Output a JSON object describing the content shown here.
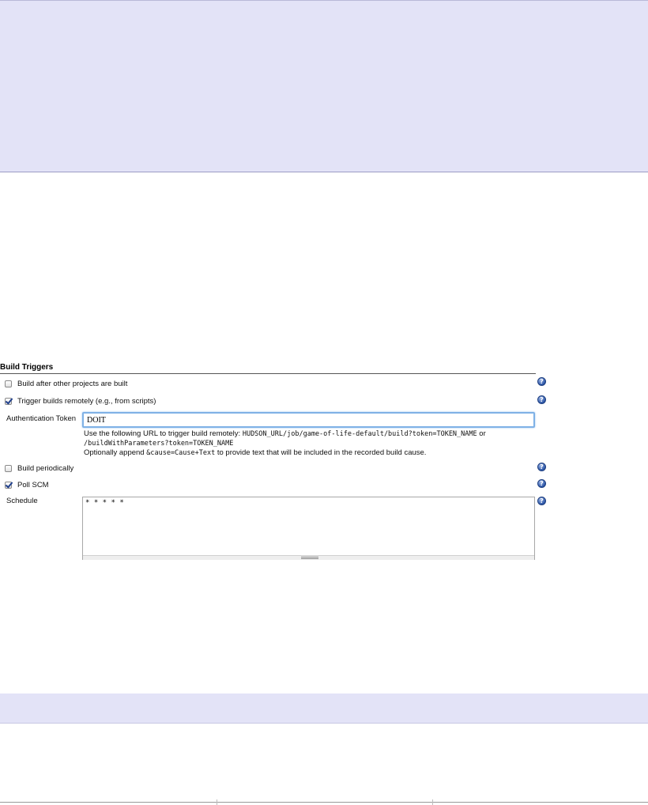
{
  "build_triggers": {
    "section_title": "Build Triggers",
    "build_after_other": {
      "label": "Build after other projects are built",
      "checked": false
    },
    "trigger_remotely": {
      "label": "Trigger builds remotely (e.g., from scripts)",
      "checked": true
    },
    "auth_token": {
      "label": "Authentication Token",
      "value": "DOIT",
      "help_line1_prefix": "Use the following URL to trigger build remotely: ",
      "help_line1_url": "HUDSON_URL/job/game-of-life-default/build?token=TOKEN_NAME",
      "help_line1_suffix": " or",
      "help_line2_url": "/buildWithParameters?token=TOKEN_NAME",
      "help_line3_prefix": "Optionally append ",
      "help_line3_code": "&cause=Cause+Text",
      "help_line3_suffix": " to provide text that will be included in the recorded build cause."
    },
    "build_periodically": {
      "label": "Build periodically",
      "checked": false
    },
    "poll_scm": {
      "label": "Poll SCM",
      "checked": true
    },
    "schedule": {
      "label": "Schedule",
      "value": "* * * * *"
    },
    "help_glyph": "?"
  },
  "colors": {
    "band": "#e3e3f7",
    "help_icon": "#2d57a8",
    "focus_border": "#7fb1e6"
  },
  "icons": {
    "help": "help-icon",
    "checkbox": "checkbox-icon",
    "resize": "resize-grip-icon"
  }
}
